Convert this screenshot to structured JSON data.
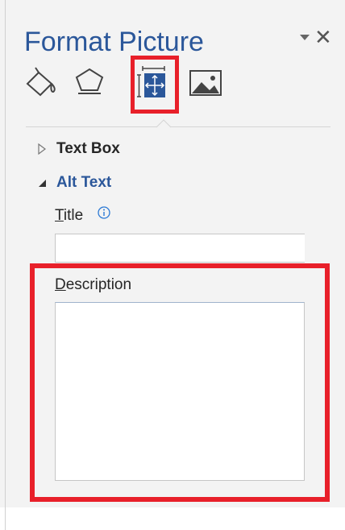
{
  "pane": {
    "title": "Format Picture"
  },
  "tabs": [
    {
      "name": "Fill & Line",
      "icon": "paint-bucket-icon"
    },
    {
      "name": "Effects",
      "icon": "pentagon-icon"
    },
    {
      "name": "Size & Properties",
      "icon": "size-properties-icon",
      "selected": true
    },
    {
      "name": "Picture",
      "icon": "picture-icon"
    }
  ],
  "sections": {
    "text_box": {
      "label": "Text Box",
      "expanded": false
    },
    "alt_text": {
      "label": "Alt Text",
      "expanded": true,
      "title_label_first": "T",
      "title_label_rest": "itle",
      "title_value": "",
      "description_label_first": "D",
      "description_label_rest": "escription",
      "description_value": ""
    }
  },
  "colors": {
    "accent": "#2b579a",
    "highlight": "#e8202a",
    "pane_background": "#f3f3f3"
  }
}
